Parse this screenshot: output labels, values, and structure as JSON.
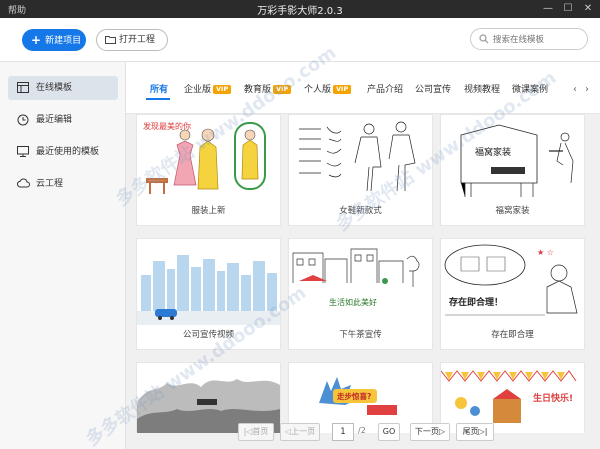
{
  "titlebar": {
    "help": "帮助",
    "title": "万彩手影大师2.0.3"
  },
  "toolbar": {
    "new_project": "新建项目",
    "open_project": "打开工程",
    "search_placeholder": "搜索在线模板"
  },
  "sidebar": {
    "items": [
      {
        "label": "在线模板",
        "icon": "template-icon",
        "active": true
      },
      {
        "label": "最近编辑",
        "icon": "clock-icon"
      },
      {
        "label": "最近使用的模板",
        "icon": "monitor-icon"
      },
      {
        "label": "云工程",
        "icon": "cloud-icon"
      }
    ]
  },
  "tabs": {
    "items": [
      {
        "label": "所有",
        "active": true
      },
      {
        "label": "企业版",
        "vip": "VIP"
      },
      {
        "label": "教育版",
        "vip": "VIP"
      },
      {
        "label": "个人版",
        "vip": "VIP"
      },
      {
        "label": "产品介绍"
      },
      {
        "label": "公司宣传"
      },
      {
        "label": "视频教程"
      },
      {
        "label": "微课案例"
      }
    ],
    "prev": "‹",
    "next": "›"
  },
  "cards": [
    {
      "name": "服装上新",
      "caption": "发现最美的你"
    },
    {
      "name": "女鞋新款式"
    },
    {
      "name": "福窝家装",
      "caption": "福窝家装"
    },
    {
      "name": "公司宣传视频"
    },
    {
      "name": "下午茶宣传",
      "caption": "生活如此美好"
    },
    {
      "name": "存在即合理",
      "caption": "存在即合理！"
    },
    {
      "name": ""
    },
    {
      "name": "",
      "caption": "走步惊喜?"
    },
    {
      "name": "",
      "caption": "生日快乐!"
    }
  ],
  "pager": {
    "first": "|◁首页",
    "prev": "◁上一页",
    "current": "1",
    "total": "/2",
    "go": "GO",
    "next": "下一页▷",
    "last": "尾页▷|"
  },
  "watermark": "多多软件站 www.ddooo.com",
  "colors": {
    "accent": "#1677e8",
    "vip": "#f5a300",
    "titlebar": "#2b2b2b"
  }
}
